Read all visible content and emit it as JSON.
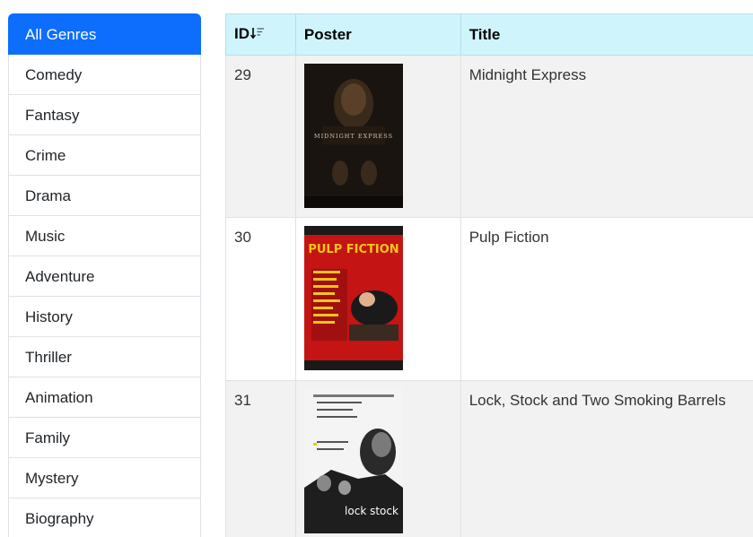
{
  "sidebar": {
    "genres": [
      {
        "label": "All Genres",
        "active": true
      },
      {
        "label": "Comedy"
      },
      {
        "label": "Fantasy"
      },
      {
        "label": "Crime"
      },
      {
        "label": "Drama"
      },
      {
        "label": "Music"
      },
      {
        "label": "Adventure"
      },
      {
        "label": "History"
      },
      {
        "label": "Thriller"
      },
      {
        "label": "Animation"
      },
      {
        "label": "Family"
      },
      {
        "label": "Mystery"
      },
      {
        "label": "Biography"
      }
    ]
  },
  "table": {
    "headers": {
      "id": "ID",
      "poster": "Poster",
      "title": "Title"
    },
    "sort_icon": "sort-descending-icon",
    "rows": [
      {
        "id": "29",
        "title": "Midnight Express",
        "poster": {
          "caption": "MIDNIGHT EXPRESS"
        }
      },
      {
        "id": "30",
        "title": "Pulp Fiction",
        "poster": {
          "caption": "PULP FICTION"
        }
      },
      {
        "id": "31",
        "title": "Lock, Stock and Two Smoking Barrels",
        "poster": {
          "caption": "lock stock"
        }
      }
    ]
  },
  "colors": {
    "active": "#0d6efd",
    "header_bg": "#cff4fc",
    "stripe": "#f2f2f2"
  }
}
